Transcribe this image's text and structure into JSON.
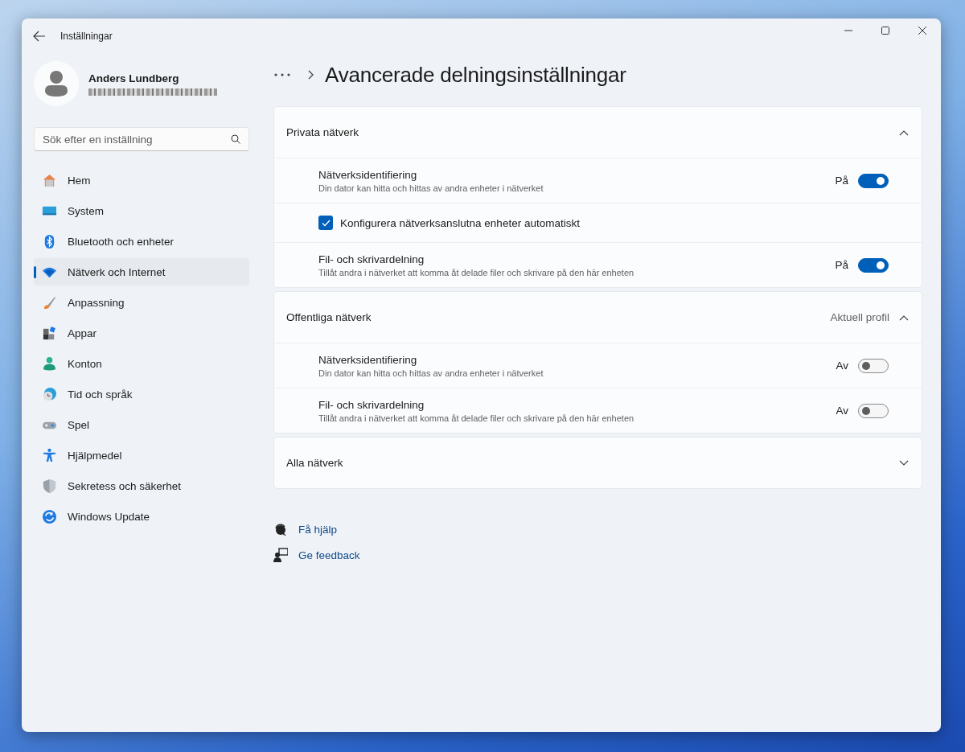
{
  "window": {
    "title": "Inställningar"
  },
  "account": {
    "name": "Anders Lundberg"
  },
  "search": {
    "placeholder": "Sök efter en inställning"
  },
  "sidebar": {
    "items": [
      {
        "label": "Hem",
        "selected": false
      },
      {
        "label": "System",
        "selected": false
      },
      {
        "label": "Bluetooth och enheter",
        "selected": false
      },
      {
        "label": "Nätverk och Internet",
        "selected": true
      },
      {
        "label": "Anpassning",
        "selected": false
      },
      {
        "label": "Appar",
        "selected": false
      },
      {
        "label": "Konton",
        "selected": false
      },
      {
        "label": "Tid och språk",
        "selected": false
      },
      {
        "label": "Spel",
        "selected": false
      },
      {
        "label": "Hjälpmedel",
        "selected": false
      },
      {
        "label": "Sekretess och säkerhet",
        "selected": false
      },
      {
        "label": "Windows Update",
        "selected": false
      }
    ]
  },
  "page": {
    "title": "Avancerade delningsinställningar"
  },
  "sections": [
    {
      "title": "Privata nätverk",
      "expanded": true,
      "rows": [
        {
          "kind": "toggle",
          "title": "Nätverksidentifiering",
          "description": "Din dator kan hitta och hittas av andra enheter i nätverket",
          "state_label": "På",
          "on": true
        },
        {
          "kind": "checkbox",
          "label": "Konfigurera nätverksanslutna enheter automatiskt",
          "checked": true
        },
        {
          "kind": "toggle",
          "title": "Fil- och skrivardelning",
          "description": "Tillåt andra i nätverket att komma åt delade filer och skrivare på den här enheten",
          "state_label": "På",
          "on": true
        }
      ]
    },
    {
      "title": "Offentliga nätverk",
      "badge": "Aktuell profil",
      "expanded": true,
      "rows": [
        {
          "kind": "toggle",
          "title": "Nätverksidentifiering",
          "description": "Din dator kan hitta och hittas av andra enheter i nätverket",
          "state_label": "Av",
          "on": false
        },
        {
          "kind": "toggle",
          "title": "Fil- och skrivardelning",
          "description": "Tillåt andra i nätverket att komma åt delade filer och skrivare på den här enheten",
          "state_label": "Av",
          "on": false
        }
      ]
    },
    {
      "title": "Alla nätverk",
      "expanded": false
    }
  ],
  "links": [
    {
      "label": "Få hjälp"
    },
    {
      "label": "Ge feedback"
    }
  ]
}
